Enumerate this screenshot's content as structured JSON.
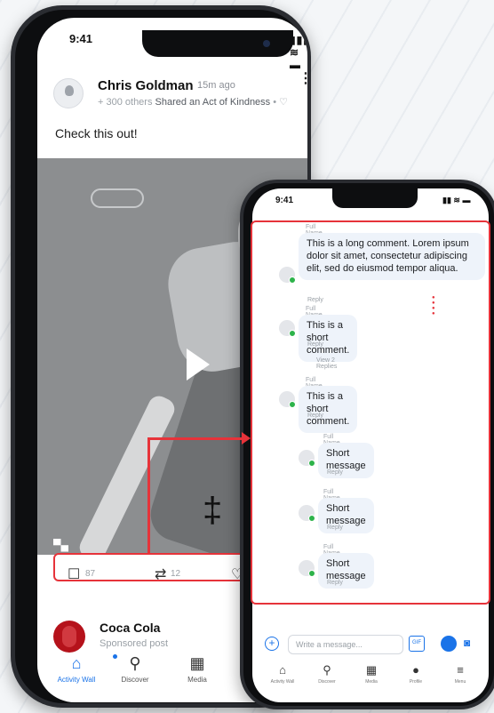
{
  "phone_a": {
    "status_time": "9:41",
    "post": {
      "author": "Chris Goldman",
      "time_ago": "15m ago",
      "subline_prefix": "+ 300 others",
      "subline_action": "Shared an Act of Kindness",
      "text": "Check this out!"
    },
    "actions": {
      "comments": "87",
      "reposts": "12"
    },
    "ad": {
      "name": "Coca Cola",
      "subtitle": "Sponsored post"
    },
    "tabs": [
      {
        "label": "Activity Wall",
        "icon": "home-icon"
      },
      {
        "label": "Discover",
        "icon": "search-icon"
      },
      {
        "label": "Media",
        "icon": "film-icon"
      },
      {
        "label": "P",
        "icon": "profile-icon"
      }
    ]
  },
  "phone_b": {
    "status_time": "9:41",
    "comments": [
      {
        "name": "Full Name",
        "text": "This is a long comment. Lorem ipsum dolor sit amet, consectetur adipiscing elit, sed do eiusmod tempor aliqua.",
        "reply": "Reply"
      },
      {
        "name": "Full Name",
        "text": "This is a short comment.",
        "reply": "Reply",
        "thread": "View 2 Replies"
      },
      {
        "name": "Full Name",
        "text": "This is a short comment.",
        "reply": "Reply"
      }
    ],
    "replies": [
      {
        "name": "Full Name",
        "text": "Short message",
        "reply": "Reply"
      },
      {
        "name": "Full Name",
        "text": "Short message",
        "reply": "Reply"
      },
      {
        "name": "Full Name",
        "text": "Short message",
        "reply": "Reply"
      }
    ],
    "composer_placeholder": "Write a message...",
    "gif_label": "GIF",
    "tabs": [
      {
        "label": "Activity Wall",
        "icon": "home-icon"
      },
      {
        "label": "Discover",
        "icon": "search-icon"
      },
      {
        "label": "Media",
        "icon": "film-icon"
      },
      {
        "label": "Profile",
        "icon": "profile-icon"
      },
      {
        "label": "Menu",
        "icon": "menu-icon"
      }
    ]
  },
  "colors": {
    "accent": "#1a73e8",
    "highlight": "#e6333a"
  }
}
